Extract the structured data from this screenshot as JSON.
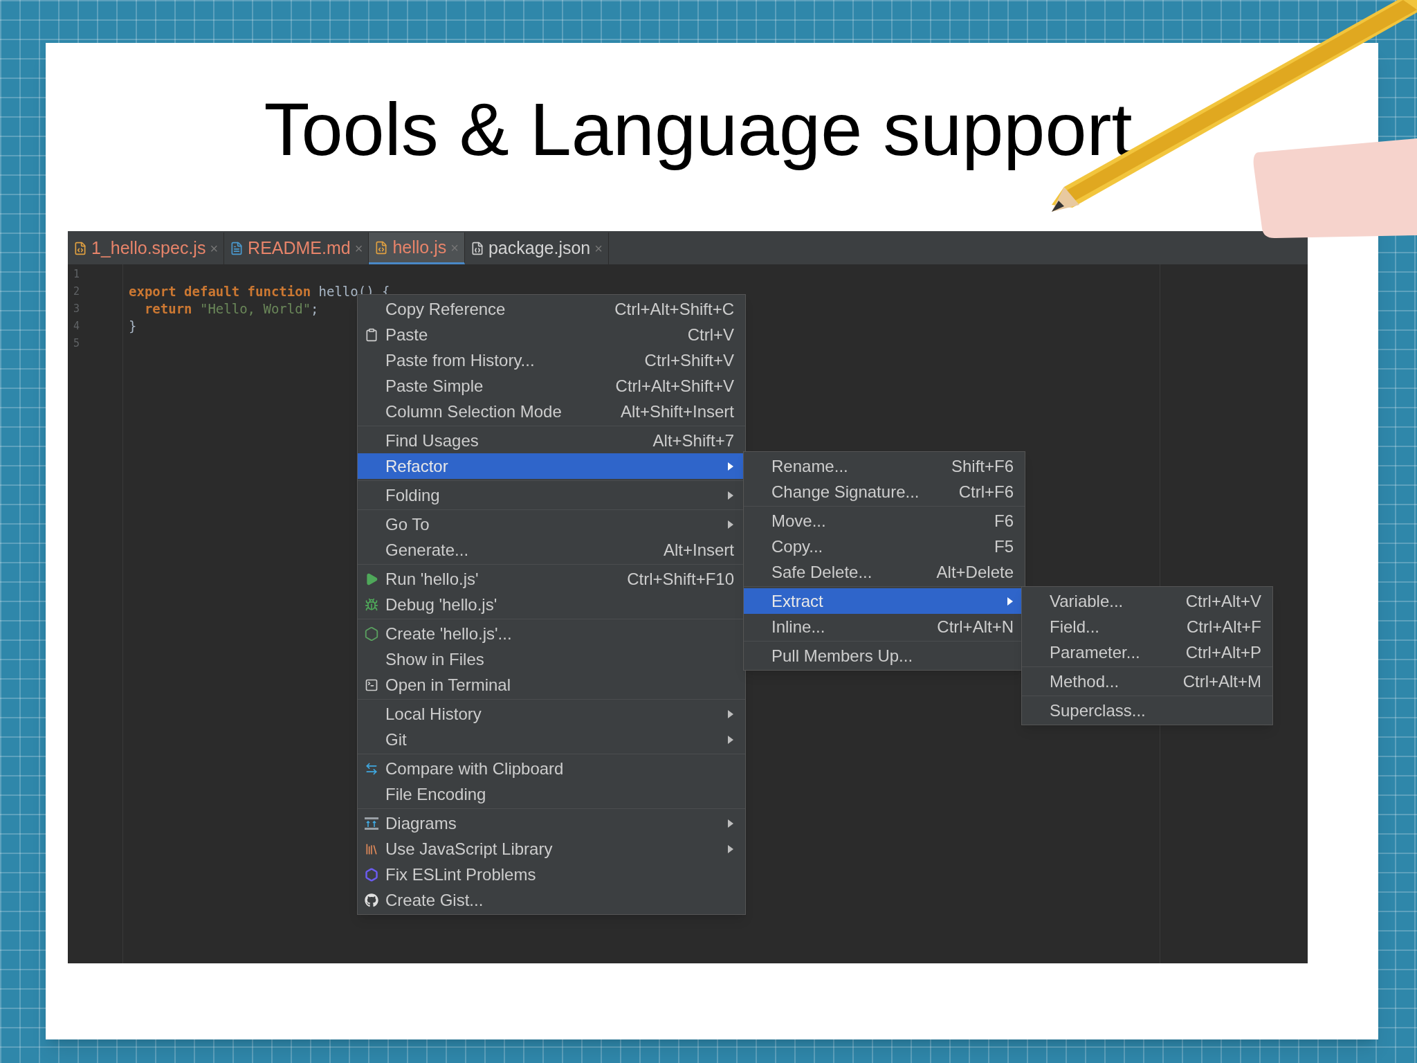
{
  "slide": {
    "title": "Tools & Language support"
  },
  "editor": {
    "tabs": [
      {
        "label": "1_hello.spec.js",
        "close": "×",
        "selected": false,
        "color": "#e8846a"
      },
      {
        "label": "README.md",
        "close": "×",
        "selected": false,
        "color": "#e8846a"
      },
      {
        "label": "hello.js",
        "close": "×",
        "selected": true,
        "color": "#e8846a"
      },
      {
        "label": "package.json",
        "close": "×",
        "selected": false,
        "color": "#d4d4d4"
      }
    ],
    "lines": [
      {
        "number": "1"
      },
      {
        "number": "2",
        "tokens": [
          {
            "kind": "keyword",
            "text": "export default function"
          },
          {
            "kind": "plain",
            "text": " hello() {"
          }
        ]
      },
      {
        "number": "3",
        "tokens": [
          {
            "kind": "keyword",
            "text": "  return"
          },
          {
            "kind": "string",
            "text": " \"Hello, World\""
          },
          {
            "kind": "plain",
            "text": ";"
          }
        ]
      },
      {
        "number": "4",
        "tokens": [
          {
            "kind": "plain",
            "text": "}"
          }
        ]
      },
      {
        "number": "5"
      }
    ]
  },
  "context_menu": {
    "groups": [
      [
        {
          "label": "Copy Reference",
          "shortcut": "Ctrl+Alt+Shift+C",
          "submenu": false,
          "selected": false
        },
        {
          "label": "Paste",
          "shortcut": "Ctrl+V",
          "submenu": false,
          "selected": false
        },
        {
          "label": "Paste from History...",
          "shortcut": "Ctrl+Shift+V",
          "submenu": false,
          "selected": false
        },
        {
          "label": "Paste Simple",
          "shortcut": "Ctrl+Alt+Shift+V",
          "submenu": false,
          "selected": false
        },
        {
          "label": "Column Selection Mode",
          "shortcut": "Alt+Shift+Insert",
          "submenu": false,
          "selected": false
        }
      ],
      [
        {
          "label": "Find Usages",
          "shortcut": "Alt+Shift+7",
          "submenu": false,
          "selected": false
        },
        {
          "label": "Refactor",
          "submenu": true,
          "selected": true
        }
      ],
      [
        {
          "label": "Folding",
          "submenu": true,
          "selected": false
        }
      ],
      [
        {
          "label": "Go To",
          "submenu": true,
          "selected": false
        },
        {
          "label": "Generate...",
          "shortcut": "Alt+Insert",
          "submenu": false,
          "selected": false
        }
      ],
      [
        {
          "label": "Run 'hello.js'",
          "shortcut": "Ctrl+Shift+F10",
          "submenu": false,
          "selected": false
        },
        {
          "label": "Debug 'hello.js'",
          "submenu": false,
          "selected": false
        }
      ],
      [
        {
          "label": "Create 'hello.js'...",
          "submenu": false,
          "selected": false
        },
        {
          "label": "Show in Files",
          "submenu": false,
          "selected": false
        },
        {
          "label": "Open in Terminal",
          "submenu": false,
          "selected": false
        }
      ],
      [
        {
          "label": "Local History",
          "submenu": true,
          "selected": false
        },
        {
          "label": "Git",
          "submenu": true,
          "selected": false
        }
      ],
      [
        {
          "label": "Compare with Clipboard",
          "submenu": false,
          "selected": false
        },
        {
          "label": "File Encoding",
          "submenu": false,
          "selected": false
        }
      ],
      [
        {
          "label": "Diagrams",
          "submenu": true,
          "selected": false
        },
        {
          "label": "Use JavaScript Library",
          "submenu": true,
          "selected": false
        },
        {
          "label": "Fix ESLint Problems",
          "submenu": false,
          "selected": false
        },
        {
          "label": "Create Gist...",
          "submenu": false,
          "selected": false
        }
      ]
    ]
  },
  "refactor_submenu": {
    "groups": [
      [
        {
          "label": "Rename...",
          "shortcut": "Shift+F6",
          "submenu": false,
          "selected": false
        },
        {
          "label": "Change Signature...",
          "shortcut": "Ctrl+F6",
          "submenu": false,
          "selected": false
        }
      ],
      [
        {
          "label": "Move...",
          "shortcut": "F6",
          "submenu": false,
          "selected": false
        },
        {
          "label": "Copy...",
          "shortcut": "F5",
          "submenu": false,
          "selected": false
        },
        {
          "label": "Safe Delete...",
          "shortcut": "Alt+Delete",
          "submenu": false,
          "selected": false
        }
      ],
      [
        {
          "label": "Extract",
          "submenu": true,
          "selected": true
        },
        {
          "label": "Inline...",
          "shortcut": "Ctrl+Alt+N",
          "submenu": false,
          "selected": false
        }
      ],
      [
        {
          "label": "Pull Members Up...",
          "submenu": false,
          "selected": false
        }
      ]
    ]
  },
  "extract_submenu": {
    "groups": [
      [
        {
          "label": "Variable...",
          "shortcut": "Ctrl+Alt+V",
          "submenu": false,
          "selected": false
        },
        {
          "label": "Field...",
          "shortcut": "Ctrl+Alt+F",
          "submenu": false,
          "selected": false
        },
        {
          "label": "Parameter...",
          "shortcut": "Ctrl+Alt+P",
          "submenu": false,
          "selected": false
        }
      ],
      [
        {
          "label": "Method...",
          "shortcut": "Ctrl+Alt+M",
          "submenu": false,
          "selected": false
        }
      ],
      [
        {
          "label": "Superclass...",
          "submenu": false,
          "selected": false
        }
      ]
    ]
  }
}
